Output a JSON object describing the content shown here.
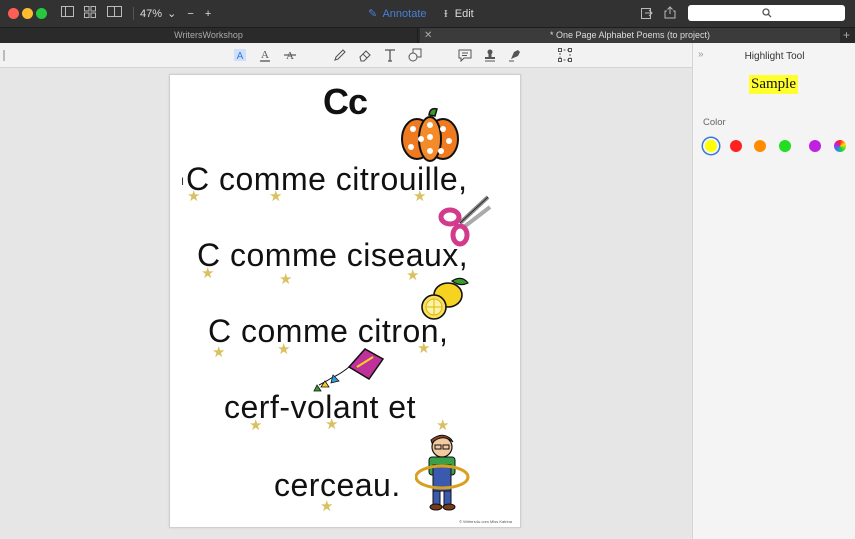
{
  "toolbar": {
    "zoom": "47%",
    "annotate_label": "Annotate",
    "edit_label": "Edit"
  },
  "tabs": [
    {
      "label": "WritersWorkshop"
    },
    {
      "label": "* One Page Alphabet Poems (to project)"
    }
  ],
  "document": {
    "title": "Cc",
    "lines": [
      "C comme citrouille,",
      "C comme ciseaux,",
      "C comme citron,",
      "cerf-volant et",
      "cerceau."
    ],
    "credit": "© Writers4u.com Miss Katrina"
  },
  "panel": {
    "title": "Highlight Tool",
    "sample": "Sample",
    "color_label": "Color",
    "colors": [
      "#ffff00",
      "#ff2020",
      "#ff8c00",
      "#22dd22",
      "#c020e0",
      "rainbow"
    ],
    "selected_color": "#ffff00"
  },
  "icons": {
    "titlebar": [
      "sidebar-icon",
      "grid-icon",
      "two-page-icon",
      "share-icon",
      "export-icon"
    ],
    "annotation_tools": [
      "highlight-text-icon",
      "underline-text-icon",
      "strikethrough-text-icon",
      "pen-icon",
      "eraser-icon",
      "text-box-icon",
      "shapes-icon",
      "note-icon",
      "stamp-icon",
      "signature-icon",
      "crop-select-icon"
    ]
  }
}
